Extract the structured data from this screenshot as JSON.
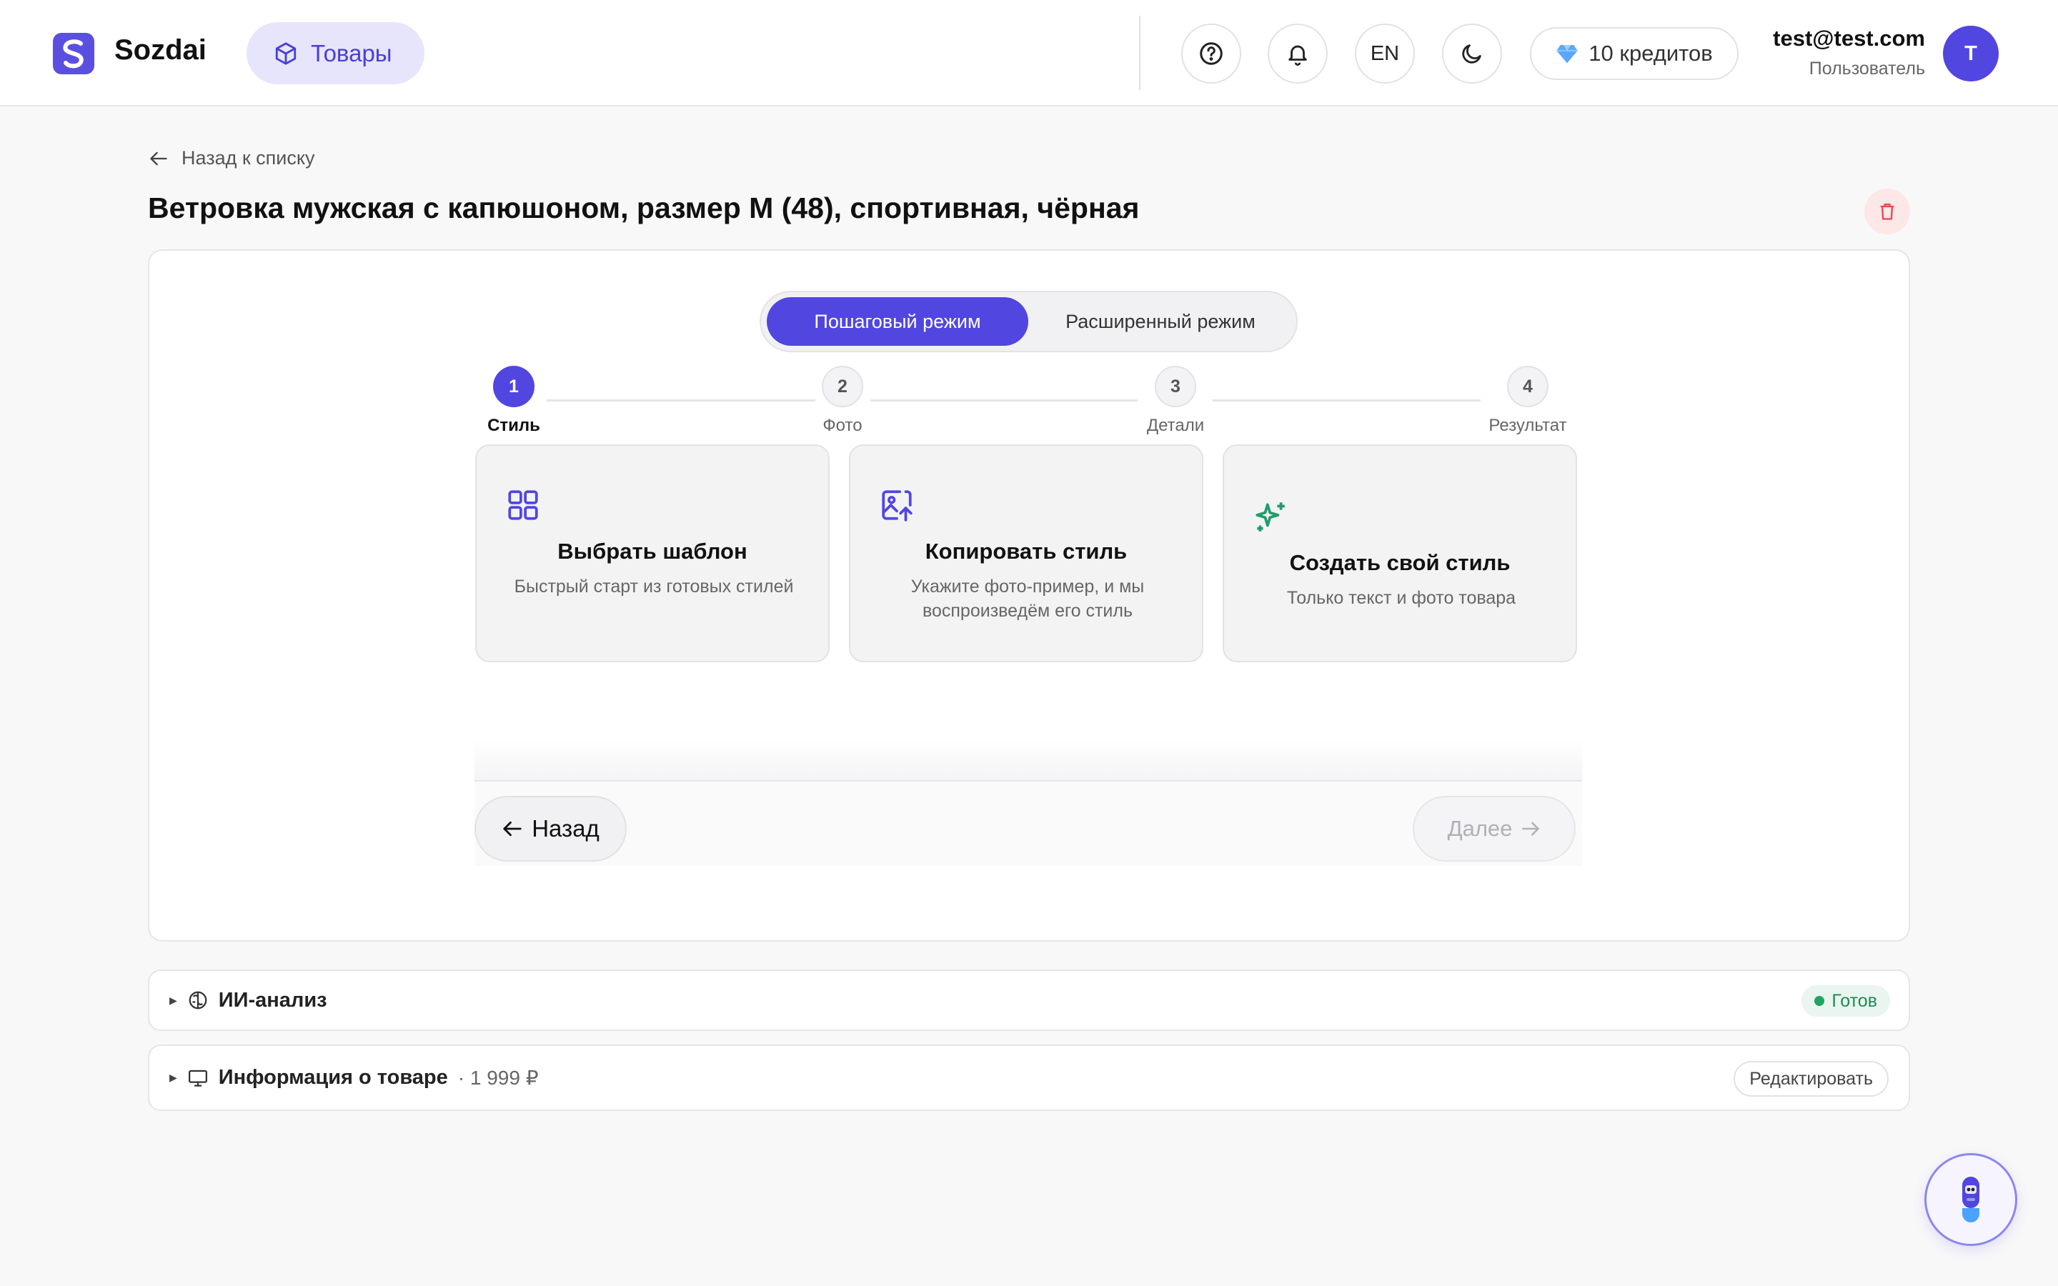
{
  "header": {
    "brand": "Sozdai",
    "nav_item": "Товары",
    "lang": "EN",
    "credits": "10 кредитов",
    "user_email": "test@test.com",
    "user_role": "Пользователь",
    "avatar_initial": "T"
  },
  "page": {
    "back_label": "Назад к списку",
    "title": "Ветровка мужская с капюшоном, размер М (48), спортивная, чёрная"
  },
  "modes": {
    "active": "Пошаговый режим",
    "inactive": "Расширенный режим"
  },
  "steps": [
    {
      "num": "1",
      "label": "Стиль"
    },
    {
      "num": "2",
      "label": "Фото"
    },
    {
      "num": "3",
      "label": "Детали"
    },
    {
      "num": "4",
      "label": "Результат"
    }
  ],
  "options": [
    {
      "title": "Выбрать шаблон",
      "desc": "Быстрый старт из готовых стилей",
      "icon": "grid-icon"
    },
    {
      "title": "Копировать стиль",
      "desc": "Укажите фото-пример, и мы воспроизведём его стиль",
      "icon": "image-upload-icon"
    },
    {
      "title": "Создать свой стиль",
      "desc": "Только текст и фото товара",
      "icon": "sparkles-icon"
    }
  ],
  "footer": {
    "back": "Назад",
    "next": "Далее"
  },
  "sections": {
    "ai": {
      "title": "ИИ-анализ",
      "status": "Готов"
    },
    "info": {
      "title": "Информация о товаре",
      "price": "· 1 999 ₽",
      "edit": "Редактировать"
    }
  },
  "colors": {
    "accent": "#5146e0",
    "success": "#1fa463",
    "danger": "#e5484d"
  }
}
